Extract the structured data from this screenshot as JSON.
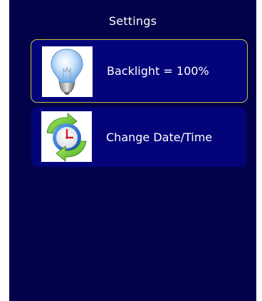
{
  "screen": {
    "title": "Settings",
    "background_color": "#02024a"
  },
  "menu": {
    "items": [
      {
        "label": "Backlight = 100%",
        "icon": "lightbulb-icon",
        "selected": true,
        "highlight_color": "#c9c23a"
      },
      {
        "label": "Change Date/Time",
        "icon": "clock-refresh-icon",
        "selected": false
      }
    ],
    "item_color": "#03037a"
  }
}
